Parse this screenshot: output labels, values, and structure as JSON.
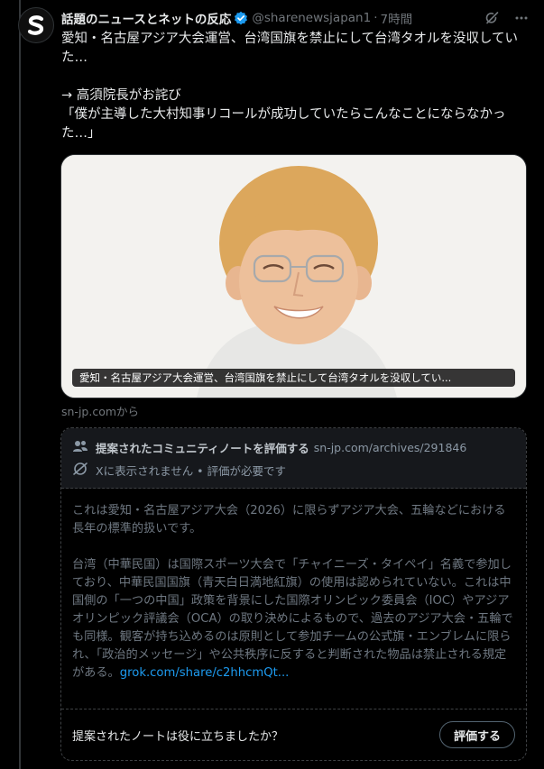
{
  "tweet": {
    "author_name": "話題のニュースとネットの反応",
    "handle": "@sharenewsjapan1",
    "separator": "·",
    "time": "7時間",
    "text": "愛知・名古屋アジア大会運営、台湾国旗を禁止にして台湾タオルを没収していた…\n\n→ 高須院長がお詫び\n「僕が主導した大村知事リコールが成功していたらこんなことにならなかった…」",
    "media_caption": "愛知・名古屋アジア大会運営、台湾国旗を禁止にして台湾タオルを没収してい...",
    "source": "sn-jp.comから"
  },
  "community_note": {
    "title": "提案されたコミュニティノートを評価する",
    "url": "sn-jp.com/archives/291846",
    "status": "Xに表示されません • 評価が必要です",
    "body": "これは愛知・名古屋アジア大会（2026）に限らずアジア大会、五輪などにおける長年の標準的扱いです。\n\n台湾（中華民国）は国際スポーツ大会で「チャイニーズ・タイペイ」名義で参加しており、中華民国国旗（青天白日満地紅旗）の使用は認められていない。これは中国側の「一つの中国」政策を背景にした国際オリンピック委員会（IOC）やアジアオリンピック評議会（OCA）の取り決めによるもので、過去のアジア大会・五輪でも同様。観客が持ち込めるのは原則として参加チームの公式旗・エンブレムに限られ、「政治的メッセージ」や公共秩序に反すると判断された物品は禁止される規定がある。",
    "link": "grok.com/share/c2hhcmQt...",
    "question": "提案されたノートは役に立ちましたか？",
    "rate_button": "評価する"
  },
  "icons": {
    "avatar": "sharenews-logo-icon",
    "verified": "verified-badge-icon",
    "grok": "grok-icon",
    "more": "more-icon",
    "people": "people-icon",
    "hidden": "eye-off-icon"
  },
  "colors": {
    "background": "#000000",
    "text": "#e7e9ea",
    "muted": "#71767b",
    "accent": "#1d9bf0",
    "border": "#2f3336"
  }
}
